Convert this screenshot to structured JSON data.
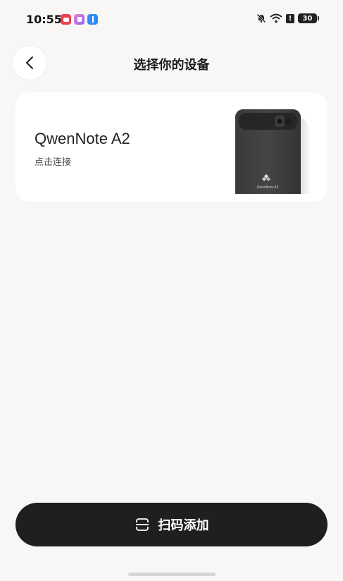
{
  "status_bar": {
    "time": "10:55",
    "battery_level": "30",
    "icons": [
      "app-red-icon",
      "app-purple-icon",
      "bluetooth-app-icon",
      "mute-bell-icon",
      "wifi-icon",
      "alert-icon",
      "battery-icon"
    ]
  },
  "header": {
    "title": "选择你的设备",
    "back_icon": "chevron-left-icon"
  },
  "device_card": {
    "name": "QwenNote A2",
    "hint": "点击连接",
    "image_label": "QwenNote A2"
  },
  "bottom": {
    "scan_add_label": "扫码添加",
    "scan_icon": "scan-icon"
  },
  "colors": {
    "background": "#f8f7f5",
    "card": "#ffffff",
    "button": "#1f1f1f"
  }
}
